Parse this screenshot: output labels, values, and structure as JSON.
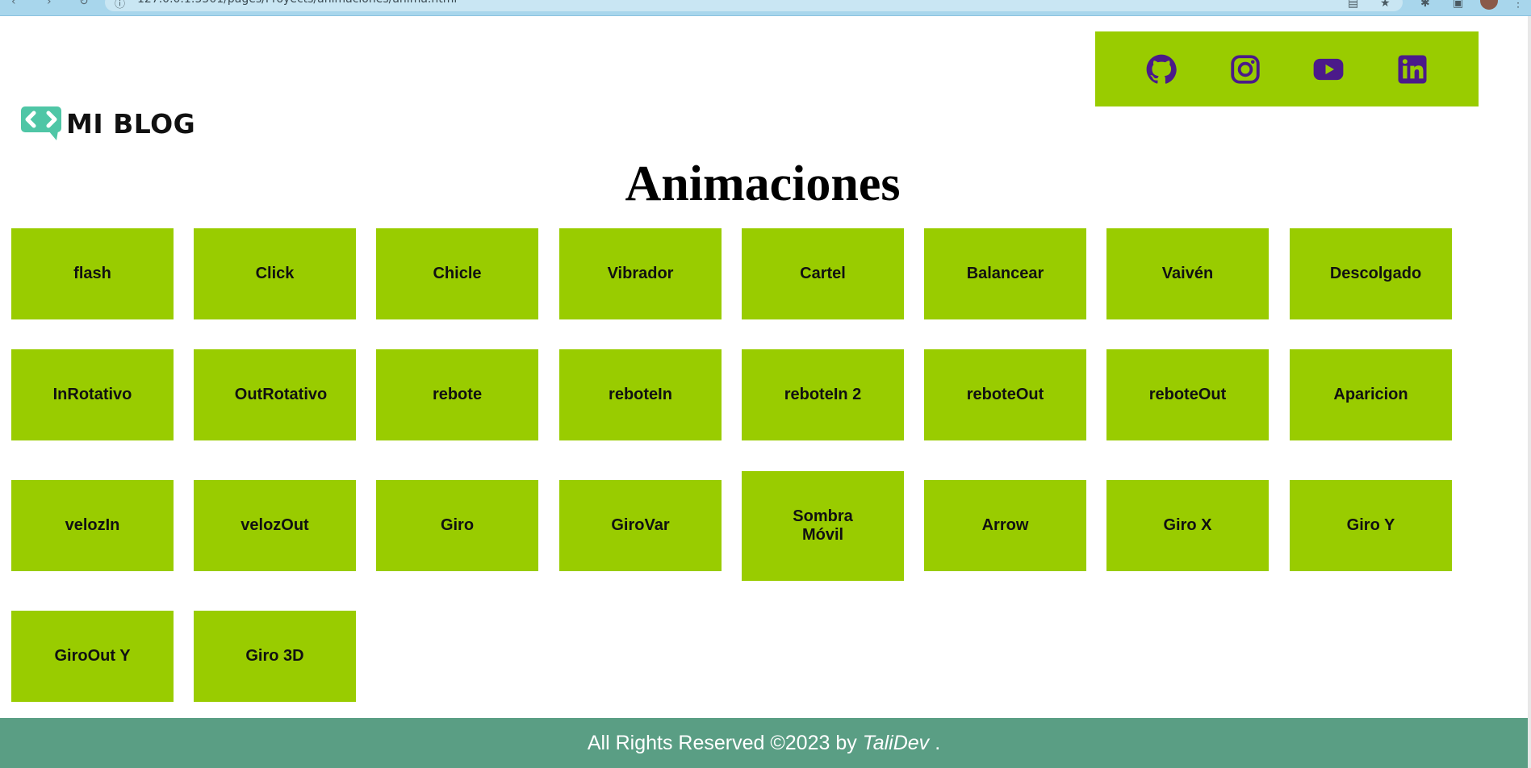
{
  "browser": {
    "url": "127.0.0.1:5501/pages/Proyects/animaciones/anima.html"
  },
  "logo": {
    "text": "MI BLOG",
    "color": "#4fc6a6"
  },
  "social": {
    "background": "#99cc00",
    "icon_color": "#4b1a8a",
    "icons": [
      "github-icon",
      "instagram-icon",
      "youtube-icon",
      "linkedin-icon"
    ]
  },
  "page": {
    "title": "Animaciones"
  },
  "tiles": [
    "flash",
    "Click",
    "Chicle",
    "Vibrador",
    "Cartel",
    "Balancear",
    "Vaivén",
    "Descolgado",
    "InRotativo",
    "OutRotativo",
    "rebote",
    "reboteIn",
    "reboteIn 2",
    "reboteOut",
    "reboteOut",
    "Aparicion",
    "velozIn",
    "velozOut",
    "Giro",
    "GiroVar",
    "Sombra Móvil",
    "Arrow",
    "Giro X",
    "Giro Y",
    "GiroOut Y",
    "Giro 3D"
  ],
  "footer": {
    "prefix": "All Rights Reserved ©2023 by",
    "author": "TaliDev",
    "suffix": "."
  },
  "colors": {
    "tile": "#99cc00",
    "footer": "#5a9e84"
  }
}
